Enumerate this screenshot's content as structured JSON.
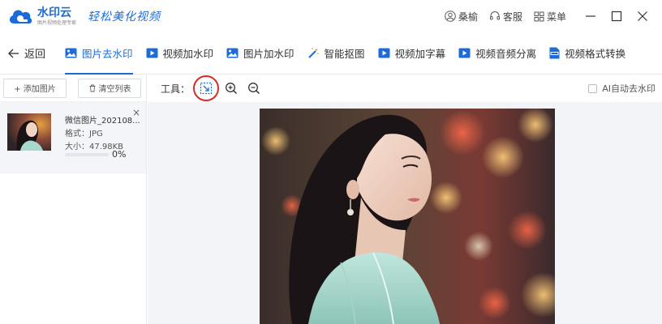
{
  "app": {
    "name": "水印云",
    "subtitle": "图片视频处理专家",
    "slogan": "轻松美化视频",
    "user": "桑榆",
    "service": "客服",
    "menu": "菜单"
  },
  "nav": {
    "back": "返回",
    "tabs": [
      {
        "label": "图片去水印",
        "icon": "image-icon",
        "active": true
      },
      {
        "label": "视频加水印",
        "icon": "video-icon",
        "active": false
      },
      {
        "label": "图片加水印",
        "icon": "image-icon",
        "active": false
      },
      {
        "label": "智能抠图",
        "icon": "magic-wand-icon",
        "active": false
      },
      {
        "label": "视频加字幕",
        "icon": "video-icon",
        "active": false
      },
      {
        "label": "视频音频分离",
        "icon": "video-icon",
        "active": false
      },
      {
        "label": "视频格式转换",
        "icon": "mp4-icon",
        "active": false
      }
    ]
  },
  "sidebar": {
    "add_label": "+ 添加图片",
    "clear_label": "清空列表",
    "file": {
      "name": "微信图片_202108...",
      "format": "格式：JPG",
      "size": "大小：47.98KB",
      "progress": "0%",
      "progress_value": 0
    }
  },
  "toolbar": {
    "label": "工具：",
    "ai_label": "AI自动去水印"
  },
  "colors": {
    "accent": "#1e6ad6",
    "highlight_ring": "#d62b2b"
  }
}
